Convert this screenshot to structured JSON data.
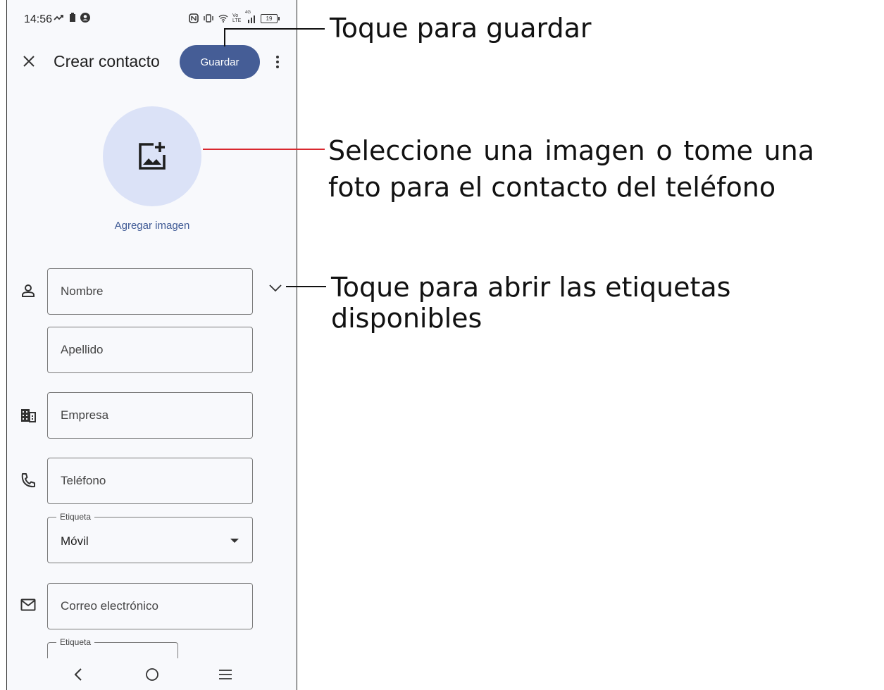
{
  "status_bar": {
    "time": "14:56",
    "left_icons": [
      "missed-call-icon",
      "battery-saver-icon",
      "account-icon"
    ],
    "right_icons": [
      "nfc-icon",
      "vibrate-icon",
      "wifi-icon",
      "volte-icon",
      "signal-icon"
    ],
    "network_label": "Vo LTE",
    "signal_type": "4G",
    "battery_level": "19"
  },
  "app_bar": {
    "close_icon": "close-icon",
    "title": "Crear contacto",
    "save_label": "Guardar",
    "more_icon": "more-vert-icon"
  },
  "photo": {
    "icon": "add-photo-icon",
    "label": "Agregar imagen"
  },
  "form": {
    "first_name_placeholder": "Nombre",
    "last_name_placeholder": "Apellido",
    "company_placeholder": "Empresa",
    "phone_placeholder": "Teléfono",
    "phone_label_legend": "Etiqueta",
    "phone_label_value": "Móvil",
    "email_placeholder": "Correo electrónico",
    "email_label_legend": "Etiqueta"
  },
  "nav_bar": {
    "icons": [
      "back-icon",
      "home-icon",
      "recents-icon"
    ]
  },
  "callouts": {
    "save": "Toque para guardar",
    "photo_line1": "Seleccione una imagen o tome una",
    "photo_line2": "foto para el contacto del teléfono",
    "labels": "Toque para abrir las etiquetas disponibles"
  },
  "colors": {
    "save_button": "#455d96",
    "avatar_bg": "#dbe2f7",
    "link": "#3f5a95",
    "callout_line": "#d9282f"
  }
}
